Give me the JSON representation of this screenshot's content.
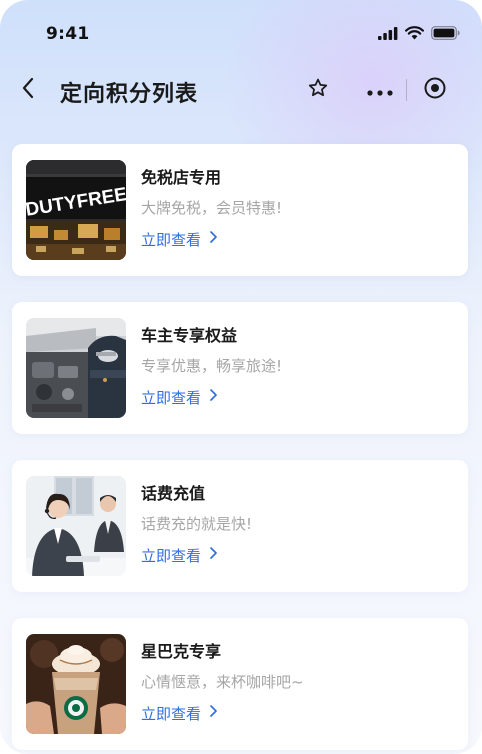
{
  "status_bar": {
    "time": "9:41",
    "icons": [
      "signal-icon",
      "wifi-icon",
      "battery-icon"
    ]
  },
  "nav": {
    "title": "定向积分列表",
    "back_icon": "chevron-left-icon",
    "star_icon": "star-outline-icon",
    "more_icon": "more-dots-icon",
    "close_icon": "target-close-icon"
  },
  "colors": {
    "accent": "#2f6fe0",
    "title_text": "#1a1a1a",
    "desc_text": "#a6a6a6",
    "card_bg": "#ffffff"
  },
  "items": [
    {
      "title": "免税店专用",
      "desc": "大牌免税，会员特惠!",
      "link": "立即查看",
      "image_text": "DUTYFREE",
      "image": "duty-free-store-photo"
    },
    {
      "title": "车主专享权益",
      "desc": "专享优惠，畅享旅途!",
      "link": "立即查看",
      "image": "car-mechanic-photo"
    },
    {
      "title": "话费充值",
      "desc": "话费充的就是快!",
      "link": "立即查看",
      "image": "call-center-photo"
    },
    {
      "title": "星巴克专享",
      "desc": "心情惬意，来杯咖啡吧~",
      "link": "立即查看",
      "image": "starbucks-drink-photo"
    }
  ]
}
